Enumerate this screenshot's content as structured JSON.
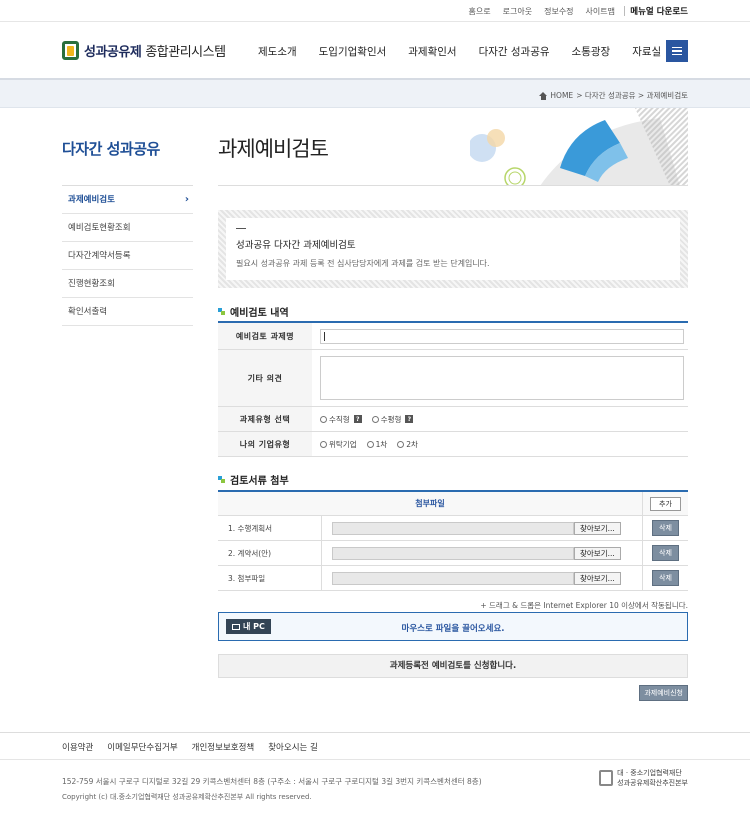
{
  "util": {
    "links": [
      "홈으로",
      "로그아웃",
      "정보수정",
      "사이트맵"
    ],
    "manual": "메뉴얼 다운로드"
  },
  "header": {
    "logo_bold": "성과공유제",
    "logo_light": "종합관리시스템",
    "nav": [
      "제도소개",
      "도입기업확인서",
      "과제확인서",
      "다자간 성과공유",
      "소통광장",
      "자료실"
    ]
  },
  "breadcrumb": {
    "home": "HOME",
    "path": " > 다자간 성과공유 > 과제예비검토"
  },
  "sidebar": {
    "title": "다자간 성과공유",
    "items": [
      "과제예비검토",
      "예비검토현황조회",
      "다자간계약서등록",
      "진행현황조회",
      "확인서출력"
    ]
  },
  "page": {
    "title": "과제예비검토"
  },
  "notice": {
    "title": "성과공유 다자간 과제예비검토",
    "desc": "필요시 성과공유 과제 등록 전 심사담당자에게 과제를 검토 받는 단계입니다."
  },
  "form": {
    "section_title": "예비검토 내역",
    "labels": [
      "예비검토 과제명",
      "기타 의견",
      "과제유형 선택",
      "나의 기업유형"
    ],
    "task_type_options": [
      "수직형",
      "수평형"
    ],
    "company_type_options": [
      "위탁기업",
      "1차",
      "2차"
    ],
    "help_glyph": "?"
  },
  "attach": {
    "section_title": "검토서류 첨부",
    "header": "첨부파일",
    "add_label": "추가",
    "browse_label": "찾아보기...",
    "delete_label": "삭제",
    "files": [
      "1. 수행계획서",
      "2. 계약서(안)",
      "3. 첨부파일"
    ],
    "dnd_note": "+ 드래그 & 드롭은 Internet Explorer 10 이상에서 작동됩니다.",
    "pc_label": "내 PC",
    "drop_text": "마우스로 파일을 끌어오세요."
  },
  "apply": {
    "message": "과제등록전 예비검토를 신청합니다.",
    "button": "과제예비신청"
  },
  "footer": {
    "links": [
      "이용약관",
      "이메일무단수집거부",
      "개인정보보호정책",
      "찾아오시는 길"
    ],
    "address": "152-759 서울시 구로구 디지털로 32길 29 키콕스벤처센터 8층 (구주소 : 서울시 구로구 구로디지털 3길 3번지 키콕스벤처센터 8층)",
    "copyright": "Copyright (c) 대.중소기업협력재단 성과공유제확산추진본부 All rights reserved.",
    "org_line1": "대 · 중소기업협력재단",
    "org_line2": "성과공유제확산추진본부"
  },
  "colors": {
    "accent": "#2a56a0",
    "sidebar_title": "#1f4f96",
    "table_border": "#2a6bb0"
  }
}
